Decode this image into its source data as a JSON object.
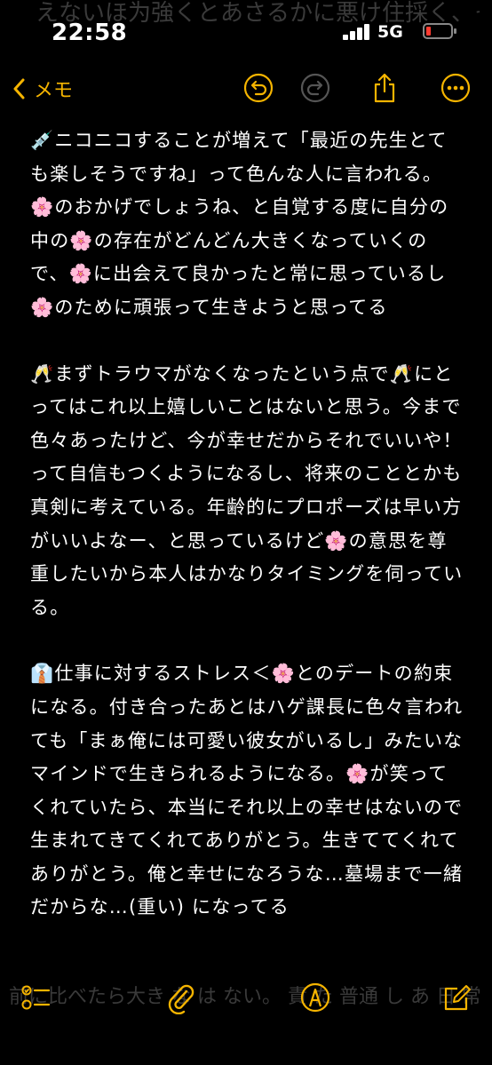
{
  "status_bar": {
    "time": "22:58",
    "network": "5G",
    "ghost_text": "えないほ为強くとあさるかに悪け住採く、そ"
  },
  "nav": {
    "back_label": "メモ",
    "accent": "#f5b400"
  },
  "note": {
    "paragraphs": [
      "💉ニコニコすることが増えて「最近の先生とても楽しそうですね」って色んな人に言われる。🌸のおかげでしょうね、と自覚する度に自分の中の🌸の存在がどんどん大きくなっていくので、🌸に出会えて良かったと常に思っているし🌸のために頑張って生きようと思ってる",
      "🥂まずトラウマがなくなったという点で🥂にとってはこれ以上嬉しいことはないと思う。今まで色々あったけど、今が幸せだからそれでいいや！って自信もつくようになるし、将来のこととかも真剣に考えている。年齢的にプロポーズは早い方がいいよなー、と思っているけど🌸の意思を尊重したいから本人はかなりタイミングを伺っている。",
      "👔仕事に対するストレス＜🌸とのデートの約束になる。付き合ったあとはハゲ課長に色々言われても「まぁ俺には可愛い彼女がいるし」みたいなマインドで生きられるようになる。🌸が笑ってくれていたら、本当にそれ以上の幸せはないので生まれてきてくれてありがとう。生きててくれてありがとう。俺と幸せになろうな…墓場まで一緒だからな…(重い) になってる"
    ]
  },
  "bottom": {
    "ghost_text": "前に比べたら大き な は ない。 責 た 普通 し あ 日 常 的 に"
  },
  "icons": {
    "back": "chevron-left-icon",
    "undo": "undo-icon",
    "redo": "redo-icon",
    "share": "share-icon",
    "more": "ellipsis-icon",
    "checklist": "checklist-icon",
    "attach": "paperclip-icon",
    "markup": "pen-tip-icon",
    "compose": "compose-icon"
  }
}
